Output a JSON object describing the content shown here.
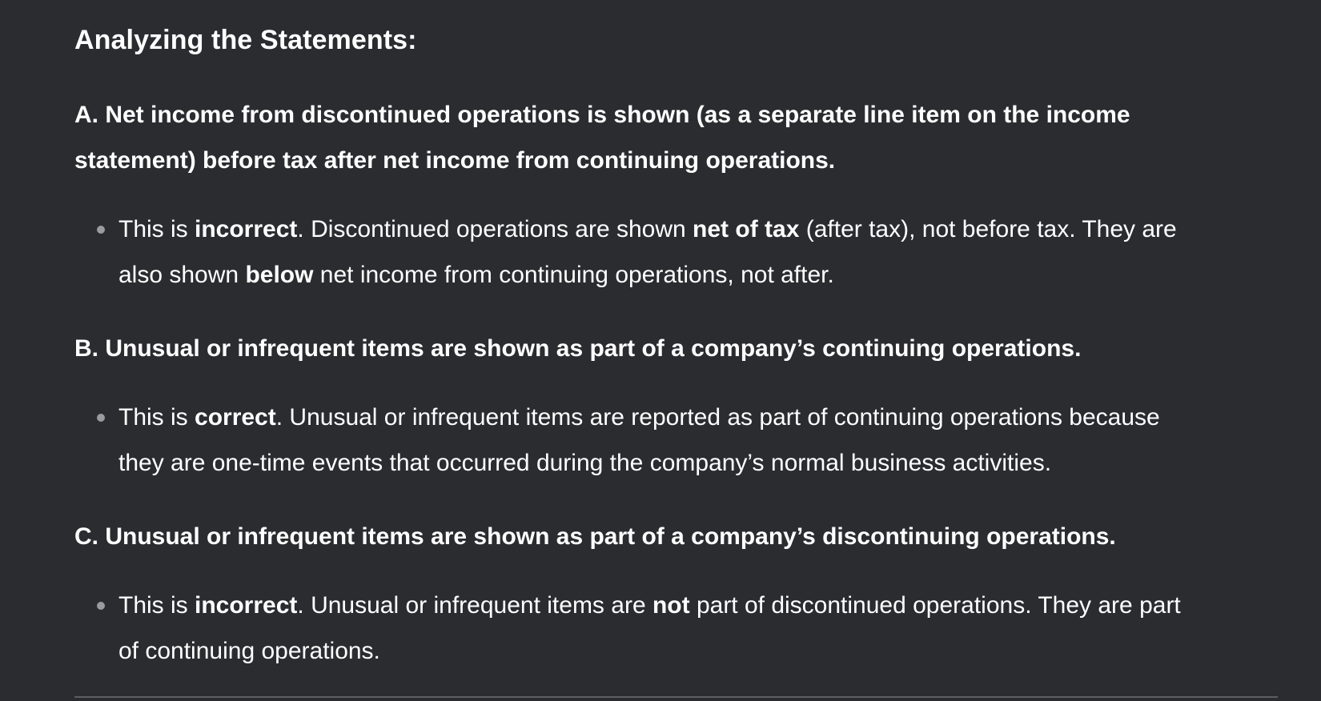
{
  "heading": "Analyzing the Statements:",
  "statements": [
    {
      "title_line1": "A. Net income from discontinued operations is shown (as a separate line item on the income",
      "title_line2": "statement) before tax after net income from continuing operations.",
      "bullet": {
        "p1": "This is ",
        "b1": "incorrect",
        "p2": ". Discontinued operations are shown ",
        "b2": "net of tax",
        "p3": " (after tax), not before tax. They are",
        "p4": "also shown ",
        "b3": "below",
        "p5": " net income from continuing operations, not after."
      }
    },
    {
      "title_line1": "B. Unusual or infrequent items are shown as part of a company’s continuing operations.",
      "bullet": {
        "p1": "This is ",
        "b1": "correct",
        "p2": ". Unusual or infrequent items are reported as part of continuing operations because",
        "p3": "they are one-time events that occurred during the company’s normal business activities."
      }
    },
    {
      "title_line1": "C. Unusual or infrequent items are shown as part of a company’s discontinuing operations.",
      "bullet": {
        "p1": "This is ",
        "b1": "incorrect",
        "p2": ". Unusual or infrequent items are ",
        "b2": "not",
        "p3": " part of discontinued operations. They are part",
        "p4": "of continuing operations."
      }
    }
  ],
  "colors": {
    "background": "#2b2c30",
    "text": "#ffffff",
    "bullet": "#9a9ba0",
    "divider": "#5d5e63"
  }
}
